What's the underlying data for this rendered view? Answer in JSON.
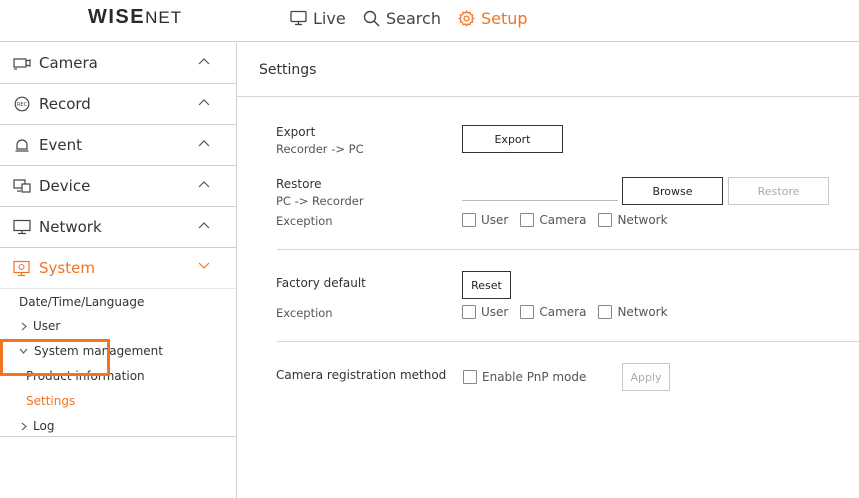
{
  "brand": {
    "logo_main": "WISE",
    "logo_sub": "NET"
  },
  "nav": {
    "live": "Live",
    "search": "Search",
    "setup": "Setup"
  },
  "sidebar": {
    "items": [
      {
        "label": "Camera"
      },
      {
        "label": "Record"
      },
      {
        "label": "Event"
      },
      {
        "label": "Device"
      },
      {
        "label": "Network"
      },
      {
        "label": "System"
      }
    ],
    "system_sub": {
      "date_time_language": "Date/Time/Language",
      "user": "User",
      "system_management": "System management",
      "product_information": "Product information",
      "settings": "Settings",
      "log": "Log"
    }
  },
  "content": {
    "title": "Settings",
    "export": {
      "label": "Export",
      "sub": "Recorder -> PC",
      "button": "Export"
    },
    "restore": {
      "label": "Restore",
      "sub": "PC -> Recorder",
      "browse": "Browse",
      "restore_btn": "Restore"
    },
    "exception_label": "Exception",
    "exception_options": [
      "User",
      "Camera",
      "Network"
    ],
    "factory": {
      "label": "Factory default",
      "button": "Reset"
    },
    "camera_reg": {
      "label": "Camera registration method",
      "checkbox": "Enable PnP mode",
      "apply": "Apply"
    }
  },
  "colors": {
    "accent": "#f37321"
  }
}
